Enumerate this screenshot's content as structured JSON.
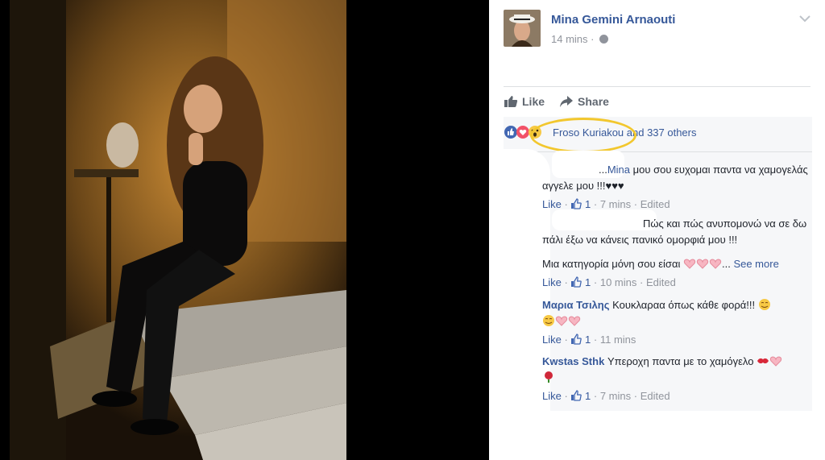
{
  "post": {
    "author": "Mina Gemini Arnaouti",
    "time": "14 mins",
    "time_separator": "·",
    "privacy_icon": "globe-icon"
  },
  "actions": {
    "like_label": "Like",
    "share_label": "Share"
  },
  "reactions": {
    "names_text": "Froso Kuriakou and 337 others",
    "icons": [
      "like-reaction-icon",
      "love-reaction-icon",
      "wow-reaction-icon"
    ]
  },
  "comments": [
    {
      "text_prefix": "...",
      "name_inline": "Mina",
      "text": " μου σου ευχομαι παντα να χαμογελάς αγγελε μου !!!♥♥♥",
      "like_label": "Like",
      "like_count": "1",
      "time": "7 mins",
      "edited": "Edited"
    },
    {
      "text": "Πώς και πώς ανυπομονώ να σε δω πάλι έξω να κάνεις πανικό ομορφιά μου !!!",
      "text2": "Μια κατηγορία μόνη σου είσαι",
      "see_more": "See more",
      "like_label": "Like",
      "like_count": "1",
      "time": "10 mins",
      "edited": "Edited"
    },
    {
      "name": "Μαρια Τσιλης",
      "text": "Κουκλαραα όπως κάθε φορά!!!",
      "like_label": "Like",
      "like_count": "1",
      "time": "11 mins"
    },
    {
      "name": "Kwstas Sthk",
      "text": "Υπεροχη παντα με το χαμόγελο",
      "like_label": "Like",
      "like_count": "1",
      "time": "7 mins",
      "edited": "Edited"
    }
  ],
  "colors": {
    "link": "#365899",
    "meta": "#90949c",
    "highlight": "#f2c72e"
  }
}
